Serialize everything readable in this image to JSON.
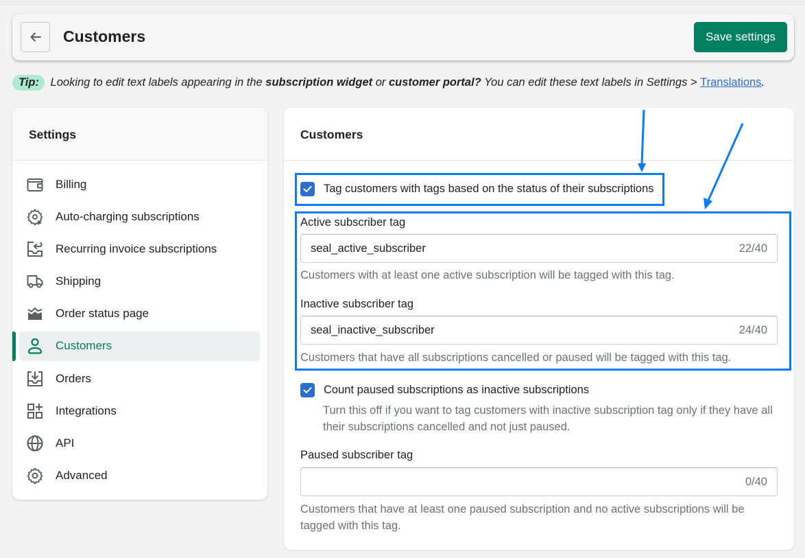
{
  "header": {
    "title": "Customers",
    "save_label": "Save settings"
  },
  "tip": {
    "badge": "Tip:",
    "text_1": "Looking to edit text labels appearing in the",
    "bold_1": "subscription widget",
    "text_2": "or",
    "bold_2": "customer portal?",
    "text_3": "You can edit these text labels in Settings >",
    "link": "Translations",
    "end": "."
  },
  "sidebar": {
    "title": "Settings",
    "items": [
      {
        "label": "Billing",
        "icon": "wallet-icon"
      },
      {
        "label": "Auto-charging subscriptions",
        "icon": "gear-play-icon"
      },
      {
        "label": "Recurring invoice subscriptions",
        "icon": "invoice-return-icon"
      },
      {
        "label": "Shipping",
        "icon": "truck-icon"
      },
      {
        "label": "Order status page",
        "icon": "order-status-icon"
      },
      {
        "label": "Customers",
        "icon": "person-icon",
        "active": true
      },
      {
        "label": "Orders",
        "icon": "inbox-download-icon"
      },
      {
        "label": "Integrations",
        "icon": "apps-plus-icon"
      },
      {
        "label": "API",
        "icon": "globe-icon"
      },
      {
        "label": "Advanced",
        "icon": "gear-icon"
      }
    ]
  },
  "main": {
    "title": "Customers",
    "tag_checkbox": {
      "label": "Tag customers with tags based on the status of their subscriptions",
      "checked": true
    },
    "active_tag": {
      "label": "Active subscriber tag",
      "value": "seal_active_subscriber",
      "count": "22/40",
      "help": "Customers with at least one active subscription will be tagged with this tag."
    },
    "inactive_tag": {
      "label": "Inactive subscriber tag",
      "value": "seal_inactive_subscriber",
      "count": "24/40",
      "help": "Customers that have all subscriptions cancelled or paused will be tagged with this tag."
    },
    "paused_checkbox": {
      "label": "Count paused subscriptions as inactive subscriptions",
      "checked": true,
      "help": "Turn this off if you want to tag customers with inactive subscription tag only if they have all their subscriptions cancelled and not just paused."
    },
    "paused_tag": {
      "label": "Paused subscriber tag",
      "value": "",
      "count": "0/40",
      "help": "Customers that have at least one paused subscription and no active subscriptions will be tagged with this tag."
    }
  },
  "colors": {
    "primary": "#008060",
    "checkbox": "#2c6ecb",
    "annotation": "#0a7cf3",
    "tip_badge": "#aee9d1"
  }
}
